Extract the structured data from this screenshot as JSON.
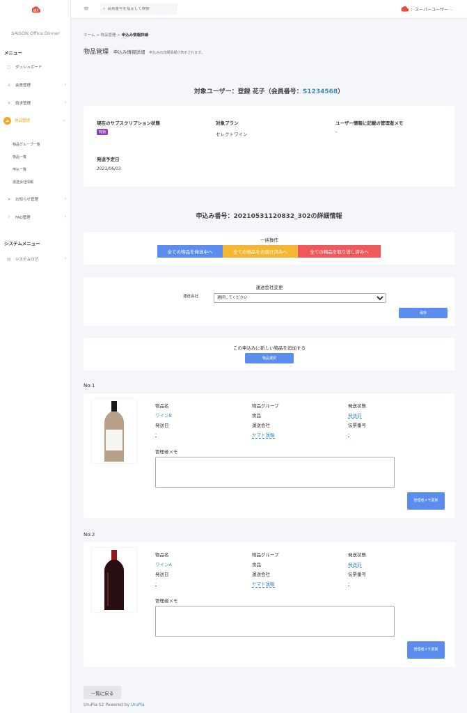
{
  "brand": "SAISON Office Dinner",
  "sidebar": {
    "menu_title": "メニュー",
    "items": [
      {
        "label": "ダッシュボード",
        "icon": "dashboard-icon"
      },
      {
        "label": "会員管理",
        "icon": "person-icon"
      },
      {
        "label": "請求管理",
        "icon": "yen-icon"
      },
      {
        "label": "物品管理",
        "icon": "cloud-icon"
      },
      {
        "label": "お知らせ管理",
        "icon": "send-icon"
      },
      {
        "label": "FAQ管理",
        "icon": "question-icon"
      }
    ],
    "sub_items": [
      "物品グループ一覧",
      "物品一覧",
      "申込一覧",
      "運送会社情報"
    ],
    "system_title": "システムメニュー",
    "system_items": [
      {
        "label": "システムログ",
        "icon": "document-icon"
      }
    ]
  },
  "topbar": {
    "search_placeholder": "会員番号を指定して検索",
    "user": "：スーパーユーザー"
  },
  "breadcrumb": {
    "home": "ホーム",
    "sep": ">",
    "items": "物品管理",
    "current": "申込み情報詳細"
  },
  "page": {
    "title": "物品管理",
    "subtitle": "申込み情報詳細",
    "desc": "申込みの詳細情報が表示されます。"
  },
  "user_heading": {
    "prefix": "対象ユーザー：登録 花子（会員番号：",
    "member_no": "S1234568",
    "suffix": "）"
  },
  "user_info": {
    "sub_status_label": "現在のサブスクリプション状態",
    "sub_status_badge": "有効",
    "plan_label": "対象プラン",
    "plan_value": "セレクトワイン",
    "memo_label": "ユーザー情報に記載の管理者メモ",
    "memo_value": "-",
    "ship_date_label": "発送予定日",
    "ship_date_value": "2021/06/03"
  },
  "order_heading": "申込み番号：20210531120832_302の詳細情報",
  "bulk": {
    "title": "一括操作",
    "btn_shipping": "全ての物品を発送中へ",
    "btn_delivered": "全ての物品をお届け済みへ",
    "btn_cancel": "全ての物品を取り消し済みへ"
  },
  "carrier_change": {
    "title": "運送会社変更",
    "label": "運送会社",
    "selected": "選択してください",
    "save": "保存"
  },
  "add_item": {
    "title": "この申込みに新しい物品を追加する",
    "button": "物品選択"
  },
  "items": [
    {
      "no": "No:1",
      "name_label": "物品名",
      "name": "ワインB",
      "group_label": "物品グループ",
      "group": "食品",
      "status_label": "発送状態",
      "status": "発送前",
      "date_label": "発送日",
      "date": "-",
      "carrier_label": "運送会社",
      "carrier": "ヤマト運輸",
      "slip_label": "伝票番号",
      "slip": "-",
      "memo_label": "管理者メモ",
      "memo_button": "管理者メモ更新"
    },
    {
      "no": "No:2",
      "name_label": "物品名",
      "name": "ワインA",
      "group_label": "物品グループ",
      "group": "食品",
      "status_label": "発送状態",
      "status": "発送前",
      "date_label": "発送日",
      "date": "-",
      "carrier_label": "運送会社",
      "carrier": "ヤマト運輸",
      "slip_label": "伝票番号",
      "slip": "-",
      "memo_label": "管理者メモ",
      "memo_button": "管理者メモ更新"
    }
  ],
  "back_button": "一覧に戻る",
  "footer": {
    "prefix": "UruPla-S2 Powered by ",
    "powered": "UruPla"
  },
  "colors": {
    "accent": "#5b8def",
    "yellow": "#f5b731",
    "red": "#f0595b",
    "active": "#f5a623",
    "badge": "#8e44ad",
    "link": "#3c8dbc"
  }
}
